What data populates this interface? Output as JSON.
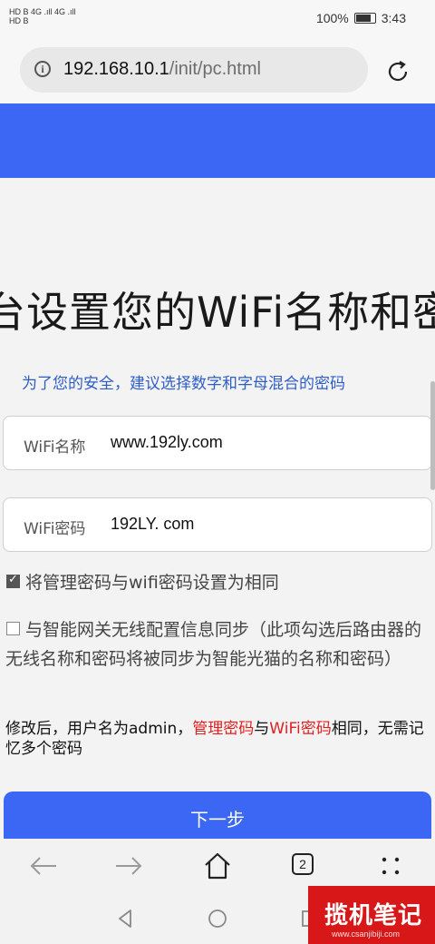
{
  "status_bar": {
    "left_line1": "HD B 4G .ıll 4G .ıll",
    "left_line2": "HD B",
    "battery": "100%",
    "time": "3:43"
  },
  "browser": {
    "url_host": "192.168.10.1",
    "url_path": "/init/pc.html",
    "tab_count": "2"
  },
  "page": {
    "title": "台设置您的WiFi名称和密",
    "subtitle": "为了您的安全，建议选择数字和字母混合的密码",
    "wifi_name_label": "WiFi名称",
    "wifi_name_value": "www.192ly.com",
    "wifi_password_label": "WiFi密码",
    "wifi_password_value": "192LY. com",
    "same_password_label": "将管理密码与wifi密码设置为相同",
    "same_password_checked": true,
    "sync_label": "与智能网关无线配置信息同步（此项勾选后路由器的无线名称和密码将被同步为智能光猫的名称和密码）",
    "sync_checked": false,
    "note_part1": "修改后，用户名为admin，",
    "note_red1": "管理密码",
    "note_part2": "与",
    "note_red2": "WiFi密码",
    "note_part3": "相同，无需记忆多个密码",
    "next_button": "下一步"
  },
  "watermark": {
    "text": "揽机笔记",
    "url": "www.csanjibiji.com"
  },
  "colors": {
    "accent_blue": "#3b67f4",
    "link_blue": "#2d5ec5",
    "highlight_red": "#e02020"
  }
}
